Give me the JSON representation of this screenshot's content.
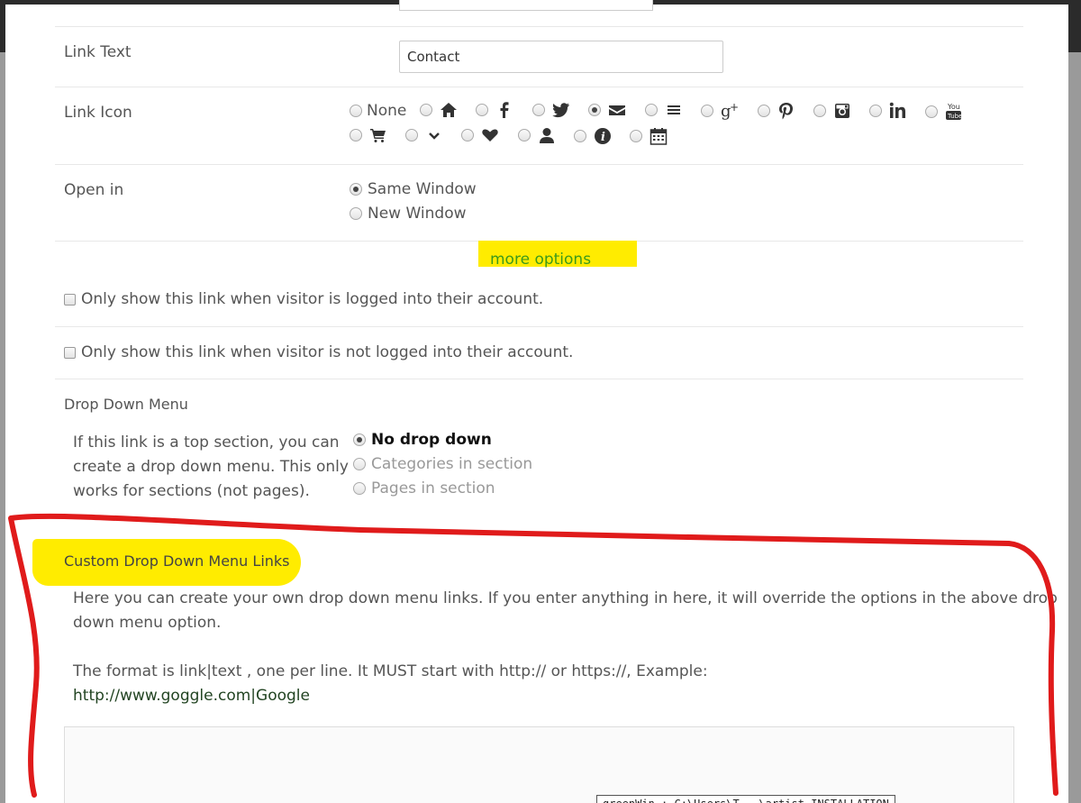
{
  "form": {
    "link_text": {
      "label": "Link Text",
      "value": "Contact"
    },
    "link_icon": {
      "label": "Link Icon",
      "none_label": "None",
      "selected": "envelope",
      "icons_row1": [
        "home",
        "facebook",
        "twitter",
        "envelope",
        "bars",
        "google-plus",
        "pinterest",
        "instagram",
        "linkedin",
        "youtube"
      ],
      "icons_row2": [
        "cart",
        "chevron-down",
        "heart",
        "user",
        "info",
        "calendar"
      ]
    },
    "open_in": {
      "label": "Open in",
      "options": [
        "Same Window",
        "New Window"
      ],
      "selected": "Same Window"
    },
    "more_options": "more options",
    "logged_in_check": "Only show this link when visitor is logged into their account.",
    "not_logged_in_check": "Only show this link when visitor is not logged into their account.",
    "drop_down": {
      "label": "Drop Down Menu",
      "help_lines": [
        "If this link is a top section, you can",
        "create a drop down menu. This only",
        "works for sections (not pages)."
      ],
      "options": [
        "No drop down",
        "Categories in section",
        "Pages in section"
      ],
      "selected": "No drop down"
    },
    "custom_links": {
      "label": "Custom Drop Down Menu Links",
      "desc_line1": "Here you can create your own drop down menu links. If you enter anything in here, it will override the options in the above drop",
      "desc_line2": "down menu option.",
      "format_line": "The format is link|text , one per line. It MUST start with http:// or https://, Example:",
      "example": "http://www.goggle.com|Google"
    }
  },
  "tooltip": "greenWin : C:\\Users\\T...\\artist_INSTALLATION_files",
  "colors": {
    "highlight": "#ffec00",
    "link_green": "#3c9a1a",
    "annotation_red": "#e01b1b"
  }
}
